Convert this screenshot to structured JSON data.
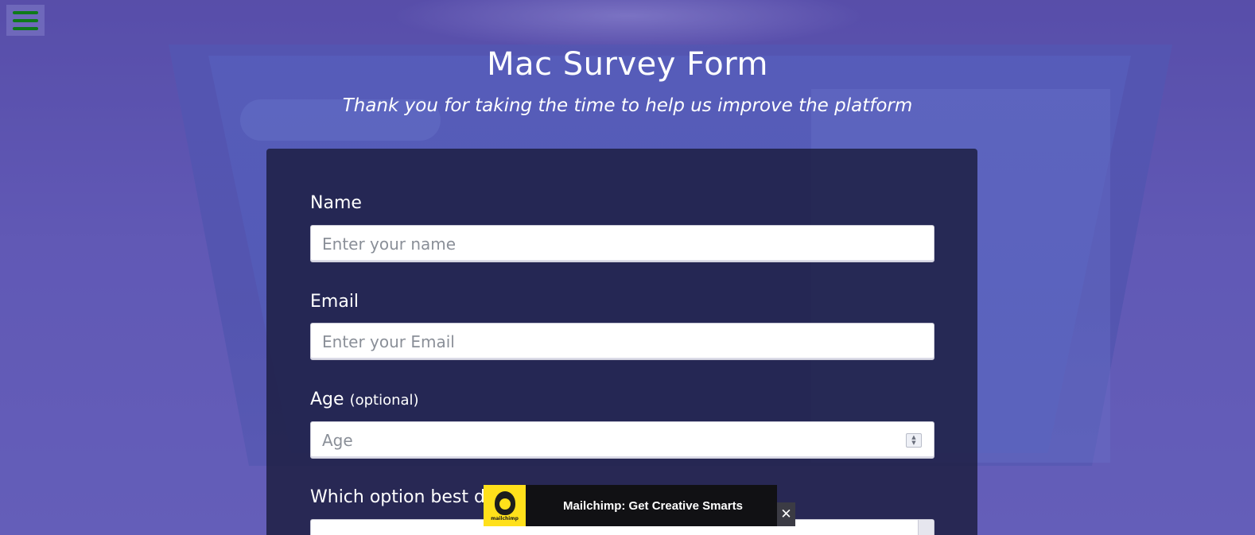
{
  "page": {
    "title": "Mac Survey Form",
    "subtitle": "Thank you for taking the time to help us improve the platform"
  },
  "form": {
    "name": {
      "label": "Name",
      "placeholder": "Enter your name",
      "value": ""
    },
    "email": {
      "label": "Email",
      "placeholder": "Enter your Email",
      "value": ""
    },
    "age": {
      "label": "Age",
      "optional_note": "(optional)",
      "placeholder": "Age",
      "value": ""
    },
    "role": {
      "label": "Which option best d"
    }
  },
  "ad": {
    "brand_word": "mailchimp",
    "text": "Mailchimp: Get Creative Smarts",
    "close_label": "✕"
  },
  "icons": {
    "menu": "hamburger-menu-icon",
    "close": "close-icon",
    "spinner": "number-spinner-icon"
  },
  "colors": {
    "menu_bars": "#0f7a1a",
    "card_background": "#1b1c3e",
    "ad_brand": "#ffe01b"
  }
}
